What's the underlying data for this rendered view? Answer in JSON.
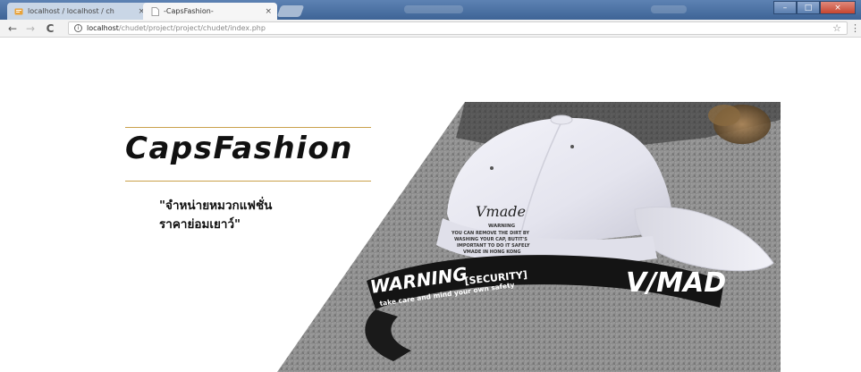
{
  "browser": {
    "tabs": [
      {
        "title": "localhost / localhost / ch",
        "active": false
      },
      {
        "title": "-CapsFashion-",
        "active": true
      }
    ],
    "tab_close_label": "×",
    "address": {
      "info_symbol": "i",
      "host": "localhost",
      "path": "/chudet/project/project/chudet/index.php"
    },
    "nav": {
      "back": "←",
      "forward": "→",
      "reload": "C"
    },
    "star": "☆",
    "menu": "⋮",
    "window_controls": {
      "minimize": "–",
      "maximize": "□",
      "close": "×"
    }
  },
  "page": {
    "brand": "CapsFashion",
    "tagline": [
      "\"จำหน่ายหมวกแฟชั่น",
      "ราคาย่อมเยาว์\""
    ],
    "hero_text": {
      "cap_brand_script": "Vmade",
      "warning_heading": "WARNING",
      "warning_lines": [
        "YOU CAN REMOVE THE DIRT BY",
        "WASHING YOUR CAP, BUTIT'S",
        "IMPORTANT TO DO IT SAFELY",
        "VMADE IN HONG KONG"
      ],
      "strap_warning": "WARNING",
      "strap_security": "[SECURITY]",
      "strap_subline": "take care and mind your own safety",
      "strap_logo": "V/MAD"
    }
  },
  "colors": {
    "tab_strip": "#4a6fa3",
    "gold_rule": "#c9a14a",
    "brand_text": "#111111"
  }
}
